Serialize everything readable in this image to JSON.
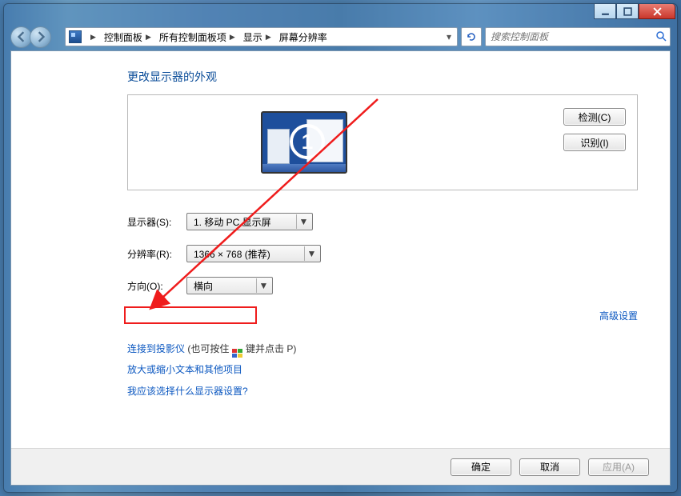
{
  "breadcrumb": {
    "items": [
      "控制面板",
      "所有控制面板项",
      "显示",
      "屏幕分辨率"
    ]
  },
  "search": {
    "placeholder": "搜索控制面板"
  },
  "page": {
    "title": "更改显示器的外观"
  },
  "side_buttons": {
    "detect": "检测(C)",
    "identify": "识别(I)"
  },
  "monitor": {
    "id": "1"
  },
  "form": {
    "display_label": "显示器(S):",
    "display_value": "1. 移动 PC 显示屏",
    "resolution_label": "分辨率(R):",
    "resolution_value": "1366 × 768 (推荐)",
    "orientation_label": "方向(O):",
    "orientation_value": "横向"
  },
  "links": {
    "advanced": "高级设置",
    "projector_prefix": "连接到投影仪",
    "projector_note": " (也可按住 ",
    "projector_key": " 键并点击 P)",
    "resize": "放大或缩小文本和其他项目",
    "whichdisplay": "我应该选择什么显示器设置?"
  },
  "buttons": {
    "ok": "确定",
    "cancel": "取消",
    "apply": "应用(A)"
  }
}
